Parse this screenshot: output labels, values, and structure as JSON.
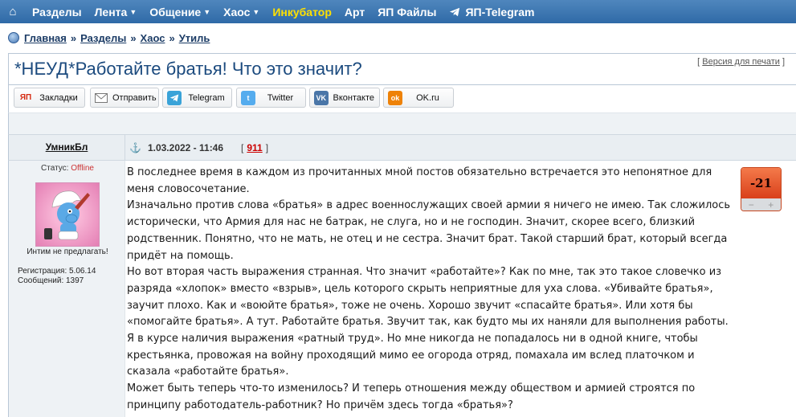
{
  "nav": {
    "items": [
      {
        "label": "Разделы",
        "caret": false
      },
      {
        "label": "Лента",
        "caret": true
      },
      {
        "label": "Общение",
        "caret": true
      },
      {
        "label": "Хаос",
        "caret": true
      },
      {
        "label": "Инкубатор",
        "caret": false,
        "highlight": true
      },
      {
        "label": "Арт",
        "caret": false
      },
      {
        "label": "ЯП Файлы",
        "caret": false
      },
      {
        "label": "ЯП-Telegram",
        "caret": false,
        "icon": "telegram-icon"
      }
    ],
    "home_icon": "home-icon",
    "colors": {
      "bar": "#3a74b0",
      "highlight": "#ffe000"
    }
  },
  "breadcrumb": {
    "items": [
      "Главная",
      "Разделы",
      "Хаос",
      "Утиль"
    ],
    "separator": "»"
  },
  "topic": {
    "title": "*НЕУД*Работайте братья! Что это значит?",
    "print_open": "[",
    "print_label": "Версия для печати",
    "print_close": "]"
  },
  "share": [
    {
      "label": "Закладки",
      "icon": "yap-icon",
      "color": "#d62a10"
    },
    {
      "label": "Отправить",
      "icon": "mail-icon",
      "color": "#888888"
    },
    {
      "label": "Telegram",
      "icon": "telegram-icon",
      "color": "#3aa3d8"
    },
    {
      "label": "Twitter",
      "icon": "twitter-icon",
      "color": "#55acee"
    },
    {
      "label": "Вконтакте",
      "icon": "vk-icon",
      "color": "#4a76a8"
    },
    {
      "label": "OK.ru",
      "icon": "ok-icon",
      "color": "#ee8208"
    }
  ],
  "post": {
    "author": "УмникБл",
    "status_label": "Статус:",
    "status_value": "Offline",
    "avatar_caption": "Интим не предлагать!",
    "registration": "Регистрация: 5.06.14",
    "messages": "Сообщений: 1397",
    "date": "1.03.2022 - 11:46",
    "post_number": "911",
    "rating": "-21",
    "rating_minus": "−",
    "rating_plus": "+",
    "paragraphs": [
      "В последнее время в каждом из прочитанных мной постов обязательно встречается это непонятное для меня словосочетание.",
      "Изначально против слова «братья» в адрес военнослужащих своей армии я ничего не имею. Так сложилось исторически, что Армия для нас не батрак, не слуга, но и не господин. Значит, скорее всего, близкий родственник. Понятно, что не мать, не отец и не сестра. Значит брат. Такой старший брат, который всегда придёт на помощь.",
      "Но вот вторая часть выражения странная. Что значит «работайте»? Как по мне, так это такое словечко из разряда «хлопок» вместо «взрыв», цель которого скрыть неприятные для уха слова. «Убивайте братья», заучит плохо. Как и «воюйте братья», тоже не очень. Хорошо звучит «спасайте братья». Или хотя бы «помогайте братья». А тут. Работайте братья. Звучит так, как будто мы их наняли для выполнения работы.",
      "Я в курсе наличия выражения «ратный труд». Но мне никогда не попадалось ни в одной книге, чтобы крестьянка, провожая на войну проходящий мимо ее огорода отряд, помахала им вслед платочком и сказала «работайте братья».",
      "Может быть теперь что-то изменилось? И теперь отношения между обществом и армией строятся по принципу работодатель-работник? Но причём здесь тогда «братья»?"
    ]
  }
}
